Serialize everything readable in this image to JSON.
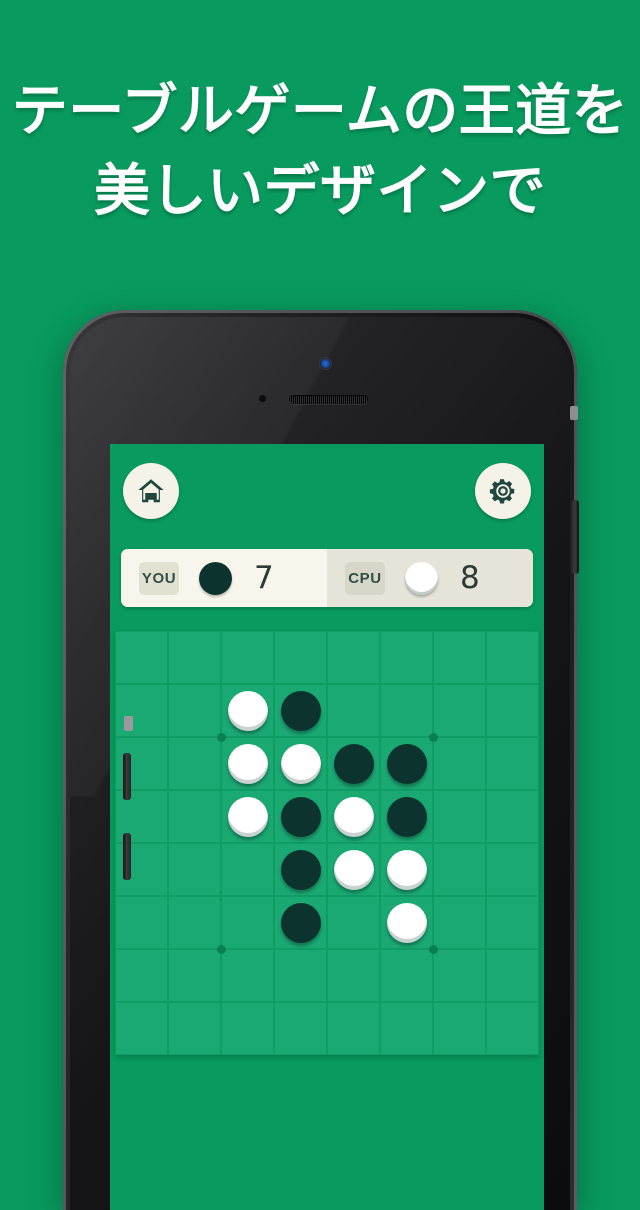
{
  "headline": {
    "line1": "テーブルゲームの王道を",
    "line2": "美しいデザインで"
  },
  "colors": {
    "background_green": "#089a5e",
    "board_green": "#1aa873",
    "board_line": "#0f9d63",
    "cream": "#f6f4e9",
    "cream_dark": "#e6e4d8",
    "disc_black": "#0d332e",
    "disc_white": "#ffffff",
    "text_dark": "#2b3a36"
  },
  "app": {
    "topbar": {
      "home_icon": "home-icon",
      "settings_icon": "gear-icon"
    },
    "score": {
      "you": {
        "label": "YOU",
        "disc": "black",
        "count": "7"
      },
      "cpu": {
        "label": "CPU",
        "disc": "white",
        "count": "8"
      }
    },
    "board": {
      "size": 8,
      "star_points": [
        [
          2,
          2
        ],
        [
          2,
          6
        ],
        [
          6,
          2
        ],
        [
          6,
          6
        ]
      ],
      "stones": [
        {
          "row": 1,
          "col": 2,
          "color": "white"
        },
        {
          "row": 1,
          "col": 3,
          "color": "black"
        },
        {
          "row": 2,
          "col": 2,
          "color": "white"
        },
        {
          "row": 2,
          "col": 3,
          "color": "white"
        },
        {
          "row": 2,
          "col": 4,
          "color": "black"
        },
        {
          "row": 2,
          "col": 5,
          "color": "black"
        },
        {
          "row": 3,
          "col": 2,
          "color": "white"
        },
        {
          "row": 3,
          "col": 3,
          "color": "black"
        },
        {
          "row": 3,
          "col": 4,
          "color": "white"
        },
        {
          "row": 3,
          "col": 5,
          "color": "black"
        },
        {
          "row": 4,
          "col": 3,
          "color": "black"
        },
        {
          "row": 4,
          "col": 4,
          "color": "white"
        },
        {
          "row": 4,
          "col": 5,
          "color": "white"
        },
        {
          "row": 5,
          "col": 3,
          "color": "black"
        },
        {
          "row": 5,
          "col": 5,
          "color": "white"
        }
      ]
    }
  },
  "device": {
    "camera_icon": "front-camera-icon",
    "sensor_icon": "ambient-sensor-icon",
    "earpiece_icon": "earpiece-speaker-icon",
    "mute_switch": "mute-switch",
    "volume_up": "volume-up-button",
    "volume_down": "volume-down-button",
    "power": "power-button"
  }
}
